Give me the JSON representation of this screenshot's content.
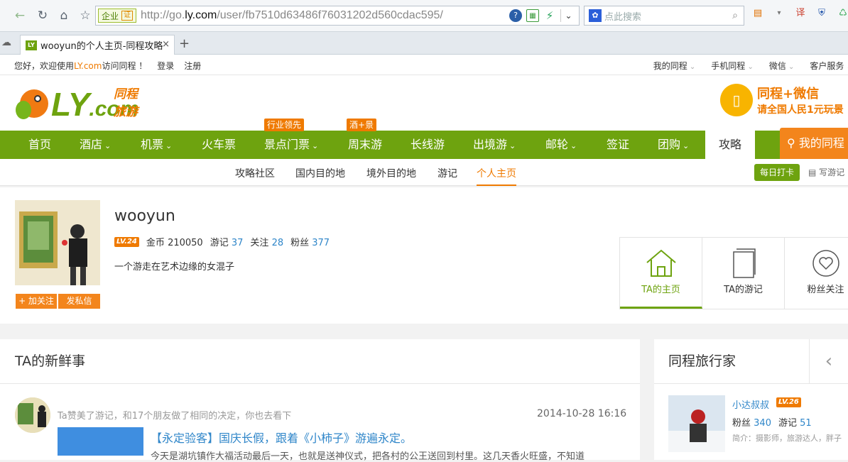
{
  "browser": {
    "cert_label": "企业",
    "cert_badge": "证",
    "url_prefix": "http://go.",
    "url_domain": "ly.com",
    "url_path": "/user/fb7510d63486f76031202d560cdac595/",
    "search_placeholder": "点此搜索",
    "tab_title": "wooyun的个人主页-同程攻略",
    "tab_favicon": "LY",
    "new_tab": "+",
    "close_tab": "×"
  },
  "topbar": {
    "welcome_prefix": "您好，欢迎使用",
    "welcome_brand": "LY.com",
    "welcome_suffix": "访问同程 ！",
    "login": "登录",
    "register": "注册",
    "right_items": [
      "我的同程",
      "手机同程",
      "微信",
      "客户服务"
    ]
  },
  "header": {
    "logo_main": "LY",
    "logo_com": ".com",
    "logo_sub": "同程旅游",
    "ad_line1": "同程+微信",
    "ad_line2": "请全国人民1元玩景"
  },
  "nav": {
    "items": [
      "首页",
      "酒店",
      "机票",
      "火车票",
      "景点门票",
      "周末游",
      "长线游",
      "出境游",
      "邮轮",
      "签证",
      "团购",
      "攻略"
    ],
    "tag_scenic": "行业领先",
    "tag_weekend": "酒+景",
    "my_tongcheng": "我的同程"
  },
  "subnav": {
    "items": [
      "攻略社区",
      "国内目的地",
      "境外目的地",
      "游记",
      "个人主页"
    ],
    "daily_checkin": "每日打卡",
    "write_note": "写游记"
  },
  "profile": {
    "username": "wooyun",
    "level": "LV.24",
    "coins_label": "金币",
    "coins": "210050",
    "notes_label": "游记",
    "notes": "37",
    "following_label": "关注",
    "following": "28",
    "fans_label": "粉丝",
    "fans": "377",
    "bio": "一个游走在艺术边缘的女混子",
    "follow_button": "+ 加关注",
    "message_button": "发私信",
    "tabs": [
      "TA的主页",
      "TA的游记",
      "粉丝关注"
    ]
  },
  "feed": {
    "heading": "TA的新鲜事",
    "desc": "Ta赞美了游记，和17个朋友做了相同的决定，你也去看下",
    "time": "2014-10-28 16:16",
    "title": "【永定验客】国庆长假，跟着《小柿子》游遍永定。",
    "text": "今天是湖坑镇作大福活动最后一天，也就是送神仪式，把各村的公王送回到村里。这几天香火旺盛，不知道"
  },
  "travelers": {
    "heading": "同程旅行家",
    "name": "小达叔叔",
    "level": "LV.26",
    "fans_label": "粉丝",
    "fans": "340",
    "notes_label": "游记",
    "notes": "51",
    "intro": "简介：摄影师，旅游达人，胖子"
  },
  "colors": {
    "brand_green": "#6ea30f",
    "brand_orange": "#ef7a00",
    "link_blue": "#2f86c9"
  }
}
